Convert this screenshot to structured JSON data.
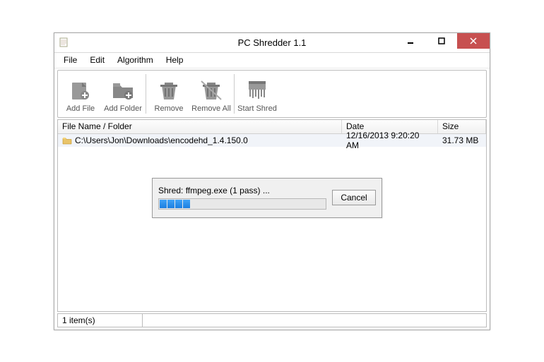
{
  "window": {
    "title": "PC Shredder 1.1"
  },
  "menu": {
    "items": [
      "File",
      "Edit",
      "Algorithm",
      "Help"
    ]
  },
  "toolbar": {
    "add_file": "Add File",
    "add_folder": "Add Folder",
    "remove": "Remove",
    "remove_all": "Remove All",
    "start_shred": "Start Shred"
  },
  "columns": {
    "name": "File Name / Folder",
    "date": "Date",
    "size": "Size"
  },
  "rows": [
    {
      "name": "C:\\Users\\Jon\\Downloads\\encodehd_1.4.150.0",
      "date": "12/16/2013 9:20:20 AM",
      "size": "31.73 MB"
    }
  ],
  "status": {
    "count": "1 item(s)"
  },
  "dialog": {
    "text": "Shred: ffmpeg.exe (1 pass) ...",
    "cancel": "Cancel"
  }
}
